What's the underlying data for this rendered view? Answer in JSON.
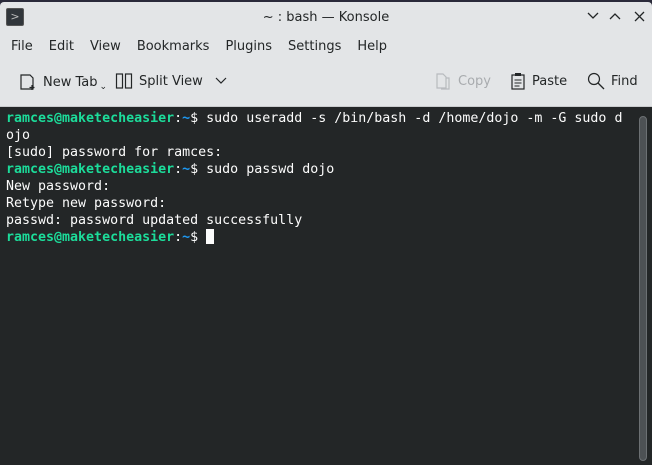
{
  "window": {
    "title": "~ : bash — Konsole"
  },
  "menu": [
    "File",
    "Edit",
    "View",
    "Bookmarks",
    "Plugins",
    "Settings",
    "Help"
  ],
  "toolbar": {
    "new_tab": "New Tab",
    "split_view": "Split View",
    "copy": "Copy",
    "paste": "Paste",
    "find": "Find"
  },
  "terminal": {
    "lines": [
      [
        {
          "t": "ramces@maketecheasier",
          "c": "g"
        },
        {
          "t": ":",
          "c": ""
        },
        {
          "t": "~",
          "c": "b"
        },
        {
          "t": "$ sudo useradd -s /bin/bash -d /home/dojo -m -G sudo d",
          "c": ""
        }
      ],
      [
        {
          "t": "ojo",
          "c": ""
        }
      ],
      [
        {
          "t": "[sudo] password for ramces:",
          "c": ""
        }
      ],
      [
        {
          "t": "ramces@maketecheasier",
          "c": "g"
        },
        {
          "t": ":",
          "c": ""
        },
        {
          "t": "~",
          "c": "b"
        },
        {
          "t": "$ sudo passwd dojo",
          "c": ""
        }
      ],
      [
        {
          "t": "New password:",
          "c": ""
        }
      ],
      [
        {
          "t": "Retype new password:",
          "c": ""
        }
      ],
      [
        {
          "t": "passwd: password updated successfully",
          "c": ""
        }
      ],
      [
        {
          "t": "ramces@maketecheasier",
          "c": "g"
        },
        {
          "t": ":",
          "c": ""
        },
        {
          "t": "~",
          "c": "b"
        },
        {
          "t": "$ ",
          "c": ""
        }
      ]
    ]
  },
  "colors": {
    "prompt_user": "#1cdc9a",
    "prompt_path": "#1d99f3",
    "background": "#232627"
  }
}
